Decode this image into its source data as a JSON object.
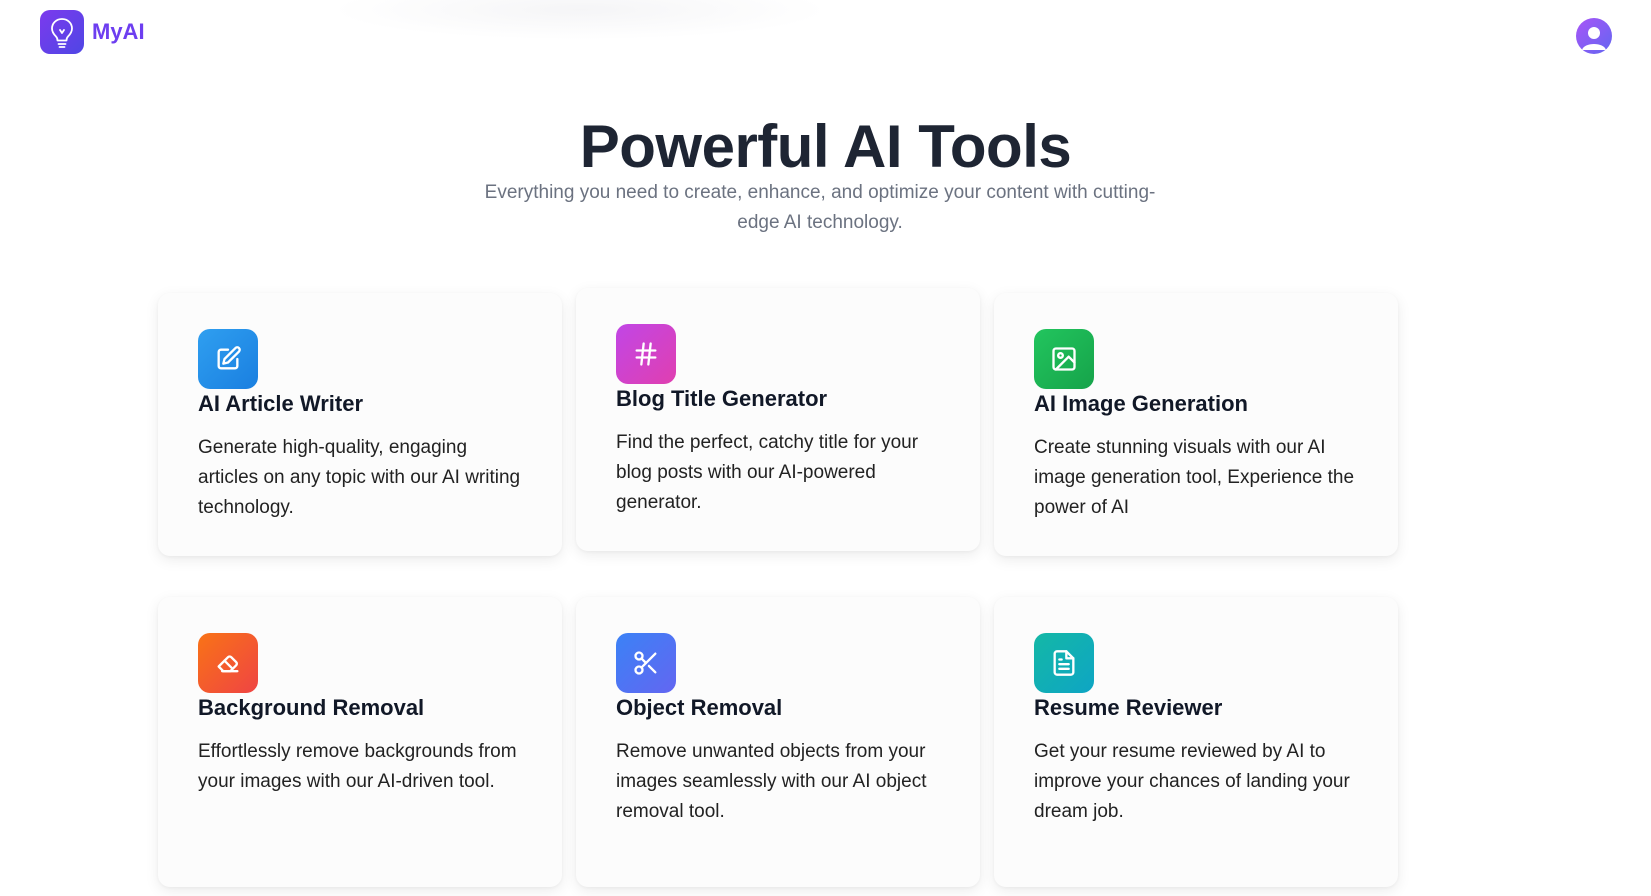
{
  "brand": {
    "name": "MyAI"
  },
  "hero": {
    "title": "Powerful AI Tools",
    "subtitle": "Everything you need to create, enhance, and optimize your content with cutting-edge AI technology."
  },
  "tools": [
    {
      "title": "AI Article Writer",
      "description": "Generate high-quality, engaging articles on any topic with our AI writing technology.",
      "icon": "edit-icon",
      "gradient": [
        "#2f9ff0",
        "#1a7fe0"
      ]
    },
    {
      "title": "Blog Title Generator",
      "description": "Find the perfect, catchy title for your blog posts with our AI-powered generator.",
      "icon": "hash-icon",
      "gradient": [
        "#c146e6",
        "#e03fb0"
      ]
    },
    {
      "title": "AI Image Generation",
      "description": "Create stunning visuals with our AI image generation tool, Experience the power of AI",
      "icon": "image-icon",
      "gradient": [
        "#22c55e",
        "#16a34a"
      ]
    },
    {
      "title": "Background Removal",
      "description": "Effortlessly remove backgrounds from your images with our AI-driven tool.",
      "icon": "eraser-icon",
      "gradient": [
        "#f97316",
        "#ef4444"
      ]
    },
    {
      "title": "Object Removal",
      "description": "Remove unwanted objects from your images seamlessly with our AI object removal tool.",
      "icon": "scissors-icon",
      "gradient": [
        "#3b82f6",
        "#6366f1"
      ]
    },
    {
      "title": "Resume Reviewer",
      "description": "Get your resume reviewed by AI to improve your chances of landing your dream job.",
      "icon": "document-icon",
      "gradient": [
        "#14b8a6",
        "#0ea5c4"
      ]
    }
  ]
}
